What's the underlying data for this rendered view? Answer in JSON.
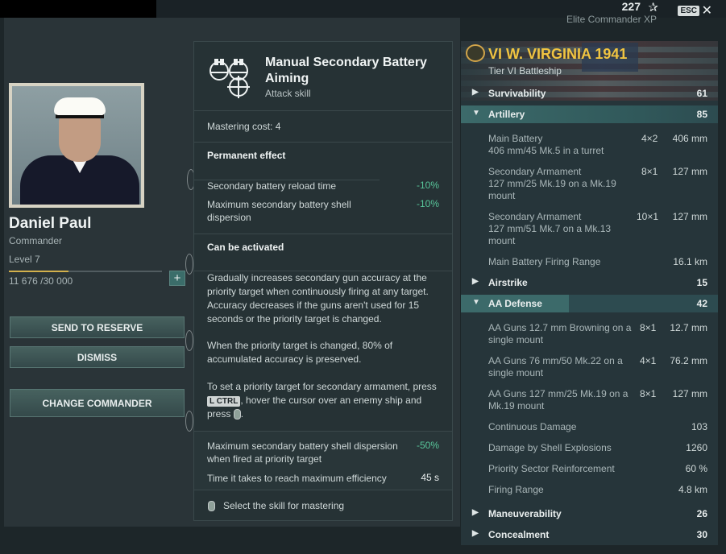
{
  "header": {
    "xp_value": "227",
    "xp_label": "Elite Commander XP",
    "esc_label": "ESC",
    "close_glyph": "✕",
    "star_glyph": "✰"
  },
  "commander": {
    "name": "Daniel Paul",
    "role": "Commander",
    "level": "Level 7",
    "xp_progress": "11 676 /30 000",
    "xp_fraction": 0.389,
    "plus_glyph": "+",
    "buttons": {
      "reserve": "SEND TO RESERVE",
      "dismiss": "DISMISS",
      "change": "CHANGE COMMANDER"
    }
  },
  "skill": {
    "title": "Manual Secondary Battery Aiming",
    "subtitle": "Attack skill",
    "mastering_cost": "Mastering cost: 4",
    "permanent_header": "Permanent effect",
    "permanent": [
      {
        "label": "Secondary battery reload time",
        "value": "-10%"
      },
      {
        "label": "Maximum secondary battery shell dispersion",
        "value": "-10%"
      }
    ],
    "activated_header": "Can be activated",
    "desc1": "Gradually increases secondary gun accuracy at the priority target when continuously firing at any target. Accuracy decreases if the guns aren't used for 15 seconds or the priority target is changed.",
    "desc2": "When the priority target is changed, 80% of accumulated accuracy is preserved.",
    "desc3_a": "To set a priority target for secondary armament, press",
    "key": "L CTRL",
    "desc3_b": ", hover the cursor over an enemy ship and press",
    "desc3_c": ".",
    "activated_stats": [
      {
        "label": "Maximum secondary battery shell dispersion when fired at priority target",
        "value": "-50%"
      },
      {
        "label": "Time it takes to reach maximum efficiency",
        "value": "45 s"
      }
    ],
    "footer": "Select the skill for mastering"
  },
  "ship": {
    "name": "VI W. VIRGINIA 1941",
    "tier": "Tier VI Battleship",
    "categories": {
      "survivability": {
        "label": "Survivability",
        "value": "61"
      },
      "artillery": {
        "label": "Artillery",
        "value": "85"
      },
      "airstrike": {
        "label": "Airstrike",
        "value": "15"
      },
      "aa_defense": {
        "label": "AA Defense",
        "value": "42"
      },
      "maneuverability": {
        "label": "Maneuverability",
        "value": "26"
      },
      "concealment": {
        "label": "Concealment",
        "value": "30"
      }
    },
    "artillery_stats": [
      {
        "name": "Main Battery",
        "detail": "406 mm/45 Mk.5 in a turret",
        "count": "4×2",
        "value": "406 mm"
      },
      {
        "name": "Secondary Armament",
        "detail": "127 mm/25 Mk.19 on a Mk.19 mount",
        "count": "8×1",
        "value": "127 mm"
      },
      {
        "name": "Secondary Armament",
        "detail": "127 mm/51 Mk.7 on a Mk.13 mount",
        "count": "10×1",
        "value": "127 mm"
      },
      {
        "name": "Main Battery Firing Range",
        "detail": "",
        "count": "",
        "value": "16.1 km"
      }
    ],
    "aa_stats": [
      {
        "name": "AA Guns 12.7 mm Browning on a single mount",
        "count": "8×1",
        "value": "12.7 mm"
      },
      {
        "name": "AA Guns 76 mm/50 Mk.22 on a single mount",
        "count": "4×1",
        "value": "76.2 mm"
      },
      {
        "name": "AA Guns 127 mm/25 Mk.19 on a Mk.19 mount",
        "count": "8×1",
        "value": "127 mm"
      }
    ],
    "aa_extra": [
      {
        "name": "Continuous Damage",
        "value": "103"
      },
      {
        "name": "Damage by Shell Explosions",
        "value": "1260"
      },
      {
        "name": "Priority Sector Reinforcement",
        "value": "60 %"
      },
      {
        "name": "Firing Range",
        "value": "4.8 km"
      }
    ]
  }
}
